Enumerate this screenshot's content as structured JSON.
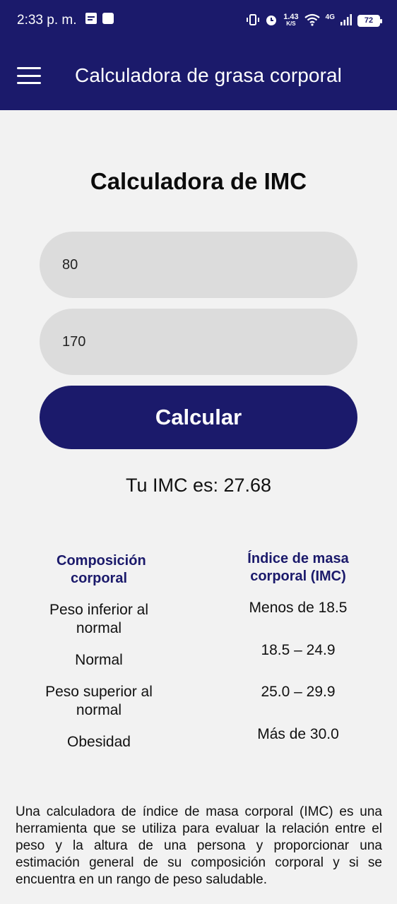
{
  "status_bar": {
    "time": "2:33 p. m.",
    "speed": "1.43",
    "speed_unit": "K/S",
    "network": "4G",
    "battery": "72"
  },
  "app_bar": {
    "title": "Calculadora de grasa corporal",
    "menu_icon": "hamburger-menu-icon"
  },
  "main": {
    "heading": "Calculadora de IMC",
    "weight_value": "80",
    "height_value": "170",
    "button_label": "Calcular",
    "result": "Tu IMC es: 27.68"
  },
  "table": {
    "headers": [
      "Composición corporal",
      "Índice de masa corporal (IMC)"
    ],
    "rows": [
      [
        "Peso inferior al normal",
        "Menos de 18.5"
      ],
      [
        "Normal",
        "18.5 – 24.9"
      ],
      [
        "Peso superior al normal",
        "25.0 – 29.9"
      ],
      [
        "Obesidad",
        "Más de 30.0"
      ]
    ]
  },
  "description": "Una calculadora de índice de masa corporal (IMC) es una herramienta que se utiliza para evaluar la relación entre el peso y la altura de una persona y proporcionar una estimación general de su composición corporal y si se encuentra en un rango de peso saludable.",
  "colors": {
    "primary": "#1b1a6b",
    "background": "#f2f2f2",
    "field": "#dcdcdc"
  }
}
